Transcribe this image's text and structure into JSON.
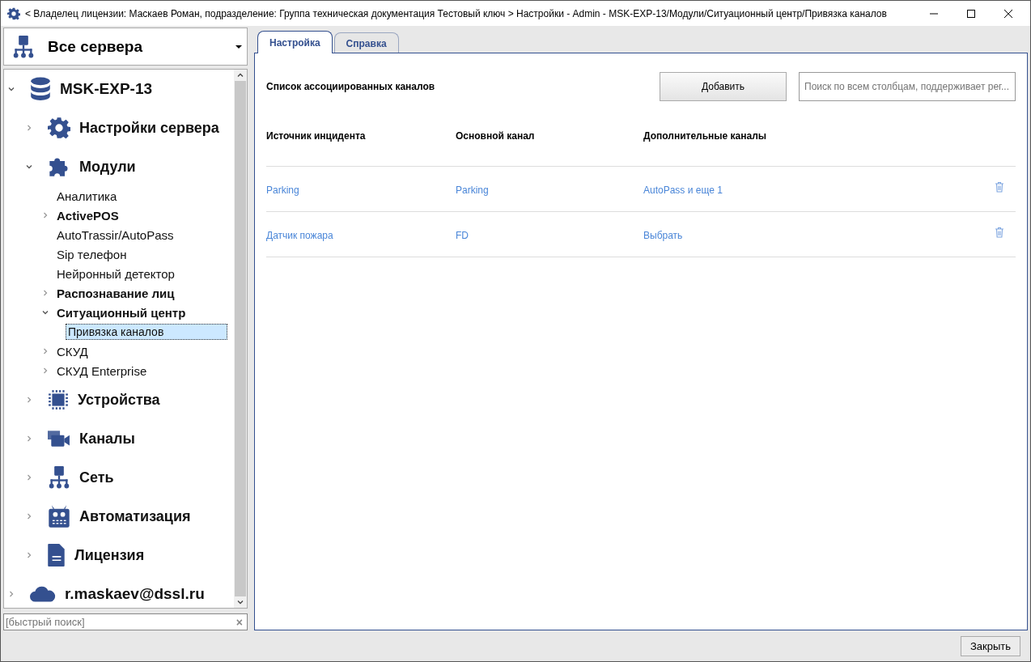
{
  "window": {
    "title": "< Владелец лицензии: Маскаев Роман, подразделение: Группа техническая документация Тестовый ключ > Настройки - Admin - MSK-EXP-13/Модули/Ситуационный центр/Привязка каналов"
  },
  "server_selector": {
    "value": "Все сервера"
  },
  "tree": {
    "items": [
      {
        "label": "MSK-EXP-13",
        "kind": "server",
        "expanded": true,
        "selected": false,
        "children": [
          {
            "label": "Настройки сервера",
            "kind": "settings",
            "expanded": false,
            "selected": false
          },
          {
            "label": "Модули",
            "kind": "modules",
            "expanded": true,
            "selected": false,
            "children": [
              {
                "label": "Аналитика",
                "emphasized": false,
                "selected": false
              },
              {
                "label": "ActivePOS",
                "emphasized": true,
                "expanded": false,
                "selected": false
              },
              {
                "label": "AutoTrassir/AutoPass",
                "emphasized": false,
                "selected": false
              },
              {
                "label": "Sip телефон",
                "emphasized": false,
                "selected": false
              },
              {
                "label": "Нейронный детектор",
                "emphasized": false,
                "selected": false
              },
              {
                "label": "Распознавание лиц",
                "emphasized": true,
                "expanded": false,
                "selected": false
              },
              {
                "label": "Ситуационный центр",
                "emphasized": true,
                "expanded": true,
                "selected": false,
                "children": [
                  {
                    "label": "Привязка каналов",
                    "selected": true
                  }
                ]
              },
              {
                "label": "СКУД",
                "emphasized": false,
                "expanded": false,
                "selected": false
              },
              {
                "label": "СКУД Enterprise",
                "emphasized": false,
                "expanded": false,
                "selected": false
              }
            ]
          },
          {
            "label": "Устройства",
            "kind": "devices",
            "expanded": false,
            "selected": false
          },
          {
            "label": "Каналы",
            "kind": "channels",
            "expanded": false,
            "selected": false
          },
          {
            "label": "Сеть",
            "kind": "network",
            "expanded": false,
            "selected": false
          },
          {
            "label": "Автоматизация",
            "kind": "automation",
            "expanded": false,
            "selected": false
          },
          {
            "label": "Лицензия",
            "kind": "license",
            "expanded": false,
            "selected": false
          }
        ]
      },
      {
        "label": "r.maskaev@dssl.ru",
        "kind": "cloud",
        "expanded": false,
        "selected": false
      }
    ]
  },
  "quick_search": {
    "placeholder": "[быстрый поиск]",
    "clear": "×"
  },
  "tabs": [
    {
      "label": "Настройка",
      "selected": true
    },
    {
      "label": "Справка",
      "selected": false
    }
  ],
  "panel": {
    "title": "Список ассоциированных каналов",
    "add_button": "Добавить",
    "search": {
      "placeholder": "Поиск по всем столбцам, поддерживает рег..."
    }
  },
  "table": {
    "columns": [
      "Источник инцидента",
      "Основной канал",
      "Дополнительные каналы"
    ],
    "rows": [
      {
        "cells": [
          "Parking",
          "Parking",
          "AutoPass и еще 1"
        ]
      },
      {
        "cells": [
          "Датчик пожара",
          "FD",
          "Выбрать"
        ]
      }
    ]
  },
  "footer": {
    "close_button": "Закрыть"
  }
}
